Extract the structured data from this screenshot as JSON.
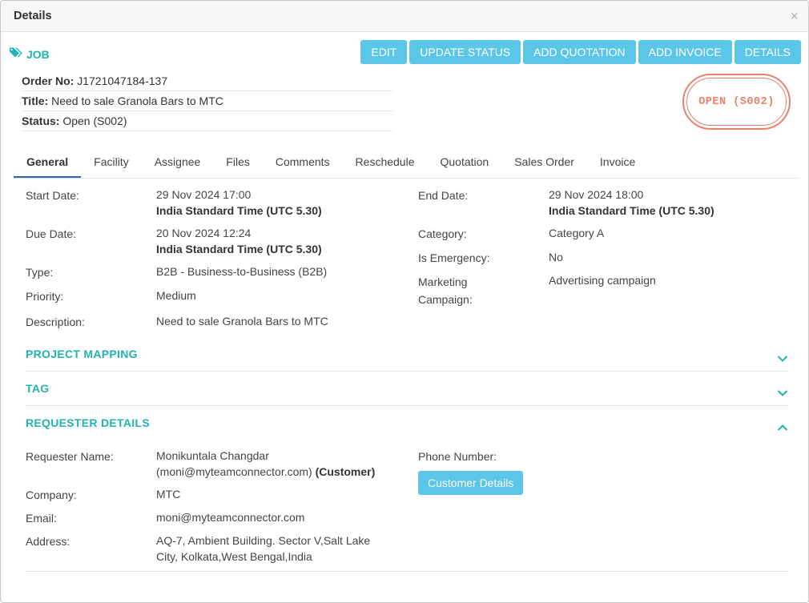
{
  "modal": {
    "title": "Details",
    "close": "×"
  },
  "job": {
    "label": "JOB"
  },
  "toolbar": {
    "edit": "EDIT",
    "update_status": "UPDATE STATUS",
    "add_quotation": "ADD QUOTATION",
    "add_invoice": "ADD INVOICE",
    "details": "DETAILS"
  },
  "info": {
    "order_label": "Order No:",
    "order_value": "J1721047184-137",
    "title_label": "Title:",
    "title_value": "Need to sale Granola Bars to MTC",
    "status_label": "Status:",
    "status_value": "Open (S002)"
  },
  "stamp": {
    "text": "OPEN (S002)",
    "color": "#e8826a"
  },
  "tabs": [
    "General",
    "Facility",
    "Assignee",
    "Files",
    "Comments",
    "Reschedule",
    "Quotation",
    "Sales Order",
    "Invoice"
  ],
  "general": {
    "start_label": "Start Date:",
    "start_date": "29 Nov 2024 17:00",
    "start_tz": "India Standard Time (UTC 5.30)",
    "end_label": "End Date:",
    "end_date": "29 Nov 2024 18:00",
    "end_tz": "India Standard Time (UTC 5.30)",
    "due_label": "Due Date:",
    "due_date": "20 Nov 2024 12:24",
    "due_tz": "India Standard Time (UTC 5.30)",
    "category_label": "Category:",
    "category_value": "Category A",
    "emergency_label": "Is Emergency:",
    "emergency_value": "No",
    "type_label": "Type:",
    "type_value": "B2B - Business-to-Business (B2B)",
    "marketing_label_1": "Marketing",
    "marketing_label_2": "Campaign:",
    "marketing_value": "Advertising campaign",
    "priority_label": "Priority:",
    "priority_value": "Medium",
    "description_label": "Description:",
    "description_value": "Need to sale Granola Bars to MTC"
  },
  "sections": {
    "project_mapping": "PROJECT MAPPING",
    "tag": "TAG",
    "requester_details": "REQUESTER DETAILS"
  },
  "requester": {
    "name_label": "Requester Name:",
    "name_value": "Monikuntala Changdar",
    "name_email": "(moni@myteamconnector.com)",
    "name_role": "(Customer)",
    "phone_label": "Phone Number:",
    "customer_details_button": "Customer Details",
    "company_label": "Company:",
    "company_value": "MTC",
    "email_label": "Email:",
    "email_value": "moni@myteamconnector.com",
    "address_label": "Address:",
    "address_line1": "AQ-7, Ambient Building. Sector V,Salt Lake",
    "address_line2": "City, Kolkata,West Bengal,India"
  },
  "colors": {
    "accent": "#1fb5ad",
    "button": "#5bc6e8",
    "tab_underline": "#2c6aa3"
  }
}
